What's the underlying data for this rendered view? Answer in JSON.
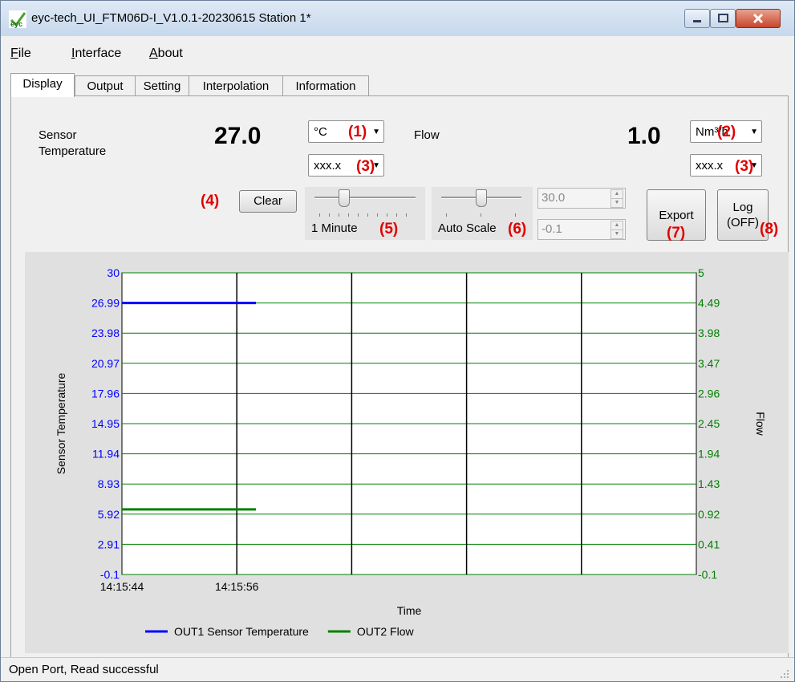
{
  "window": {
    "title": "eyc-tech_UI_FTM06D-I_V1.0.1-20230615  Station 1*"
  },
  "menu": [
    {
      "first": "F",
      "rest": "ile"
    },
    {
      "first": "I",
      "rest": "nterface"
    },
    {
      "first": "A",
      "rest": "bout"
    }
  ],
  "tabs": [
    "Display",
    "Output",
    "Setting",
    "Interpolation",
    "Information"
  ],
  "display": {
    "temp_label_1": "Sensor",
    "temp_label_2": "Temperature",
    "temp_value": "27.0",
    "temp_unit": "°C",
    "temp_format": "xxx.x",
    "flow_label": "Flow",
    "flow_value": "1.0",
    "flow_unit": "Nm³/h",
    "flow_format": "xxx.x",
    "clear_label": "Clear",
    "time_slider_label": "1 Minute",
    "autoscale_label": "Auto Scale",
    "scale_max": "30.0",
    "scale_min": "-0.1",
    "export_label": "Export",
    "log_label_1": "Log",
    "log_label_2": "(OFF)"
  },
  "annotations": {
    "a1": "(1)",
    "a2": "(2)",
    "a3_left": "(3)",
    "a3_right": "(3)",
    "a4": "(4)",
    "a5": "(5)",
    "a6": "(6)",
    "a7": "(7)",
    "a8": "(8)"
  },
  "status": {
    "text": "Open Port,   Read successful"
  },
  "chart_data": {
    "type": "line",
    "xlabel": "Time",
    "ylabel": "Sensor Temperature",
    "y2label": "Flow",
    "x_ticks": [
      "14:15:44",
      "14:15:56"
    ],
    "y_ticks": [
      "30",
      "26.99",
      "23.98",
      "20.97",
      "17.96",
      "14.95",
      "11.94",
      "8.93",
      "5.92",
      "2.91",
      "-0.1"
    ],
    "y2_ticks": [
      "5",
      "4.49",
      "3.98",
      "3.47",
      "2.96",
      "2.45",
      "1.94",
      "1.43",
      "0.92",
      "0.41",
      "-0.1"
    ],
    "ylim": [
      -0.1,
      30
    ],
    "y2lim": [
      -0.1,
      5
    ],
    "x_range_seconds": [
      0,
      60
    ],
    "series": [
      {
        "name": "OUT1 Sensor Temperature",
        "axis": "left",
        "color": "#0000ff",
        "x_seconds": [
          0,
          14
        ],
        "values": [
          26.99,
          26.99
        ]
      },
      {
        "name": "OUT2 Flow",
        "axis": "right",
        "color": "#008000",
        "x_seconds": [
          0,
          14
        ],
        "values": [
          1.0,
          1.0
        ]
      }
    ],
    "colors": {
      "left_axis": "#0000ff",
      "right_axis": "#008000",
      "hgrid": "#008000",
      "vgrid": "#000000"
    }
  }
}
